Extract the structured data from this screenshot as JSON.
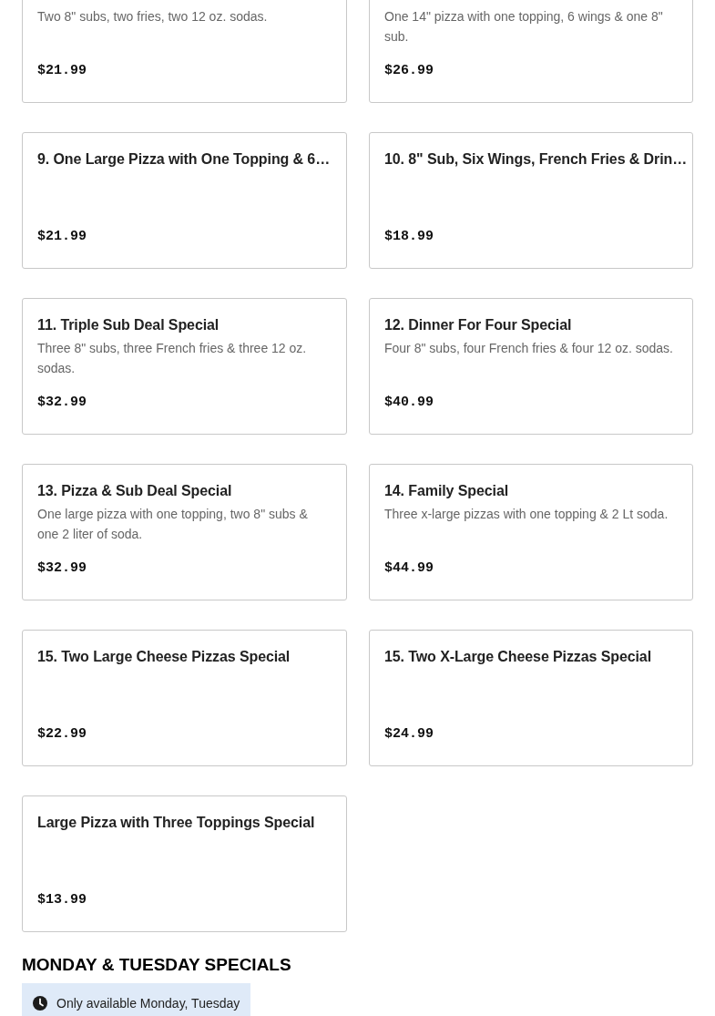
{
  "deals": [
    {
      "description": "Two 8\" subs, two fries, two 12 oz. sodas.",
      "price": "$21.99"
    },
    {
      "description": "One 14\" pizza with one topping, 6 wings & one 8\" sub.",
      "price": "$26.99"
    },
    {
      "title": "9. One Large Pizza with One Topping & 6…",
      "price": "$21.99"
    },
    {
      "title": "10. 8\" Sub, Six Wings, French Fries & Drin…",
      "price": "$18.99"
    },
    {
      "title": "11. Triple Sub Deal Special",
      "description": "Three 8\" subs, three French fries & three 12 oz. sodas.",
      "price": "$32.99"
    },
    {
      "title": "12. Dinner For Four Special",
      "description": "Four 8\" subs, four French fries & four 12 oz. sodas.",
      "price": "$40.99"
    },
    {
      "title": "13. Pizza & Sub Deal Special",
      "description": "One large pizza with one topping, two 8\" subs & one 2 liter of soda.",
      "price": "$32.99"
    },
    {
      "title": "14. Family Special",
      "description": "Three x-large pizzas with one topping & 2 Lt soda.",
      "price": "$44.99"
    },
    {
      "title": "15. Two Large Cheese Pizzas Special",
      "price": "$22.99"
    },
    {
      "title": "15. Two X-Large Cheese Pizzas Special",
      "price": "$24.99"
    },
    {
      "title": "Large Pizza with Three Toppings Special",
      "price": "$13.99"
    }
  ],
  "section": {
    "heading": "MONDAY & TUESDAY SPECIALS",
    "availability": "Only available Monday, Tuesday"
  }
}
